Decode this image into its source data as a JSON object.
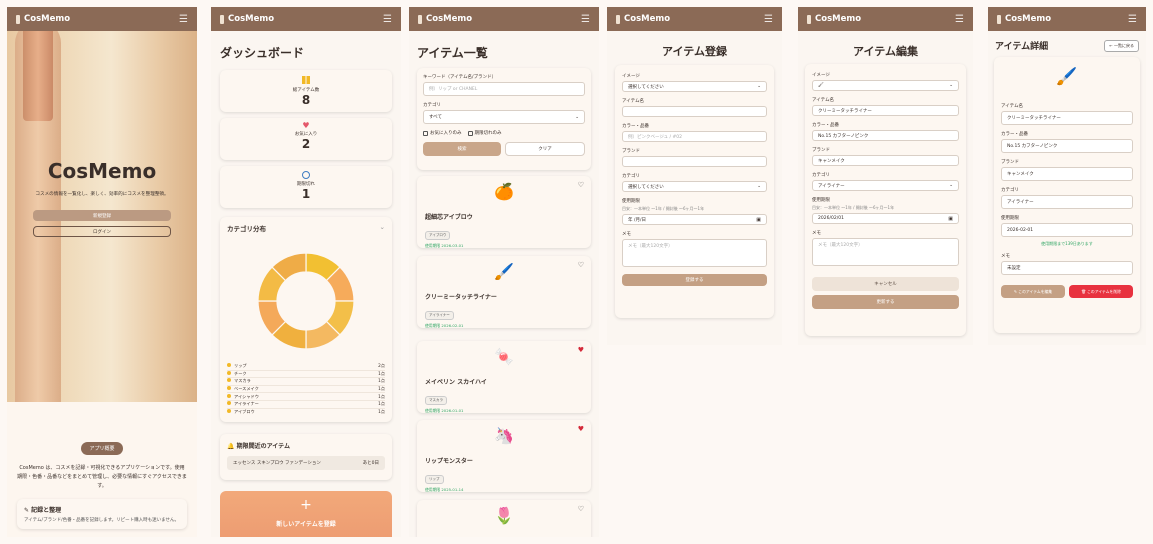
{
  "app": {
    "name": "CosMemo"
  },
  "landing": {
    "hero_title": "CosMemo",
    "hero_text": "コスメの情報を一覧化し、楽しく、効率的にコスメを整理整頓。",
    "register_btn": "新規登録",
    "login_btn": "ログイン",
    "about_badge": "アプリ概要",
    "about_text": "CosMemo は、コスメを記録・可視化できるアプリケーションです。使用期限・色番・品番などをまとめて管理し、必要な情報にすぐアクセスできます。",
    "feature_title": "記録と整理",
    "feature_text": "アイテム/ブランド/色番・品番を記録します。リピート購入時も迷いません。"
  },
  "dashboard": {
    "title": "ダッシュボード",
    "stats": [
      {
        "label": "総アイテム数",
        "value": "8"
      },
      {
        "label": "お気に入り",
        "value": "2"
      },
      {
        "label": "期限切れ",
        "value": "1"
      }
    ],
    "category_title": "カテゴリ分布",
    "legend": [
      {
        "name": "リップ",
        "count": "2点"
      },
      {
        "name": "チーク",
        "count": "1点"
      },
      {
        "name": "マスカラ",
        "count": "1点"
      },
      {
        "name": "ベースメイク",
        "count": "1点"
      },
      {
        "name": "アイシャドウ",
        "count": "1点"
      },
      {
        "name": "アイライナー",
        "count": "1点"
      },
      {
        "name": "アイブロウ",
        "count": "1点"
      }
    ],
    "expiry_title": "期限間近のアイテム",
    "expiry_item": "エッセンス スキンプロウ ファンデーション",
    "expiry_days": "あと0日",
    "add_label": "新しいアイテムを登録",
    "chart_colors": [
      "#f2c032",
      "#f6ab5b",
      "#f3bf49",
      "#f4b961",
      "#f0b03e",
      "#f4a95a",
      "#f3bb45",
      "#efac47"
    ]
  },
  "list": {
    "title": "アイテム一覧",
    "keyword_label": "キーワード（アイテム名/ブランド）",
    "keyword_ph": "例）リップ or CHANEL",
    "category_label": "カテゴリ",
    "category_val": "すべて",
    "fav_only": "お気に入りのみ",
    "expired_only": "期限切れのみ",
    "search_btn": "検索",
    "clear_btn": "クリア",
    "items": [
      {
        "emoji": "🍊",
        "name": "超細芯アイブロウ",
        "tag": "アイブロウ",
        "exp": "使用期限 2026-03-01",
        "fav": false
      },
      {
        "emoji": "🖌️",
        "name": "クリーミータッチライナー",
        "tag": "アイライナー",
        "exp": "使用期限 2026-02-01",
        "fav": false
      },
      {
        "emoji": "🍬",
        "name": "メイベリン スカイハイ",
        "tag": "マスカラ",
        "exp": "使用期限 2026-01-01",
        "fav": true
      },
      {
        "emoji": "🦄",
        "name": "リップモンスター",
        "tag": "リップ",
        "exp": "使用期限 2025-01-14",
        "fav": true
      },
      {
        "emoji": "🌷",
        "name": "",
        "tag": "",
        "exp": "",
        "fav": false
      }
    ]
  },
  "register": {
    "title": "アイテム登録",
    "image_label": "イメージ",
    "image_ph": "選択してください",
    "name_label": "アイテム名",
    "color_label": "カラー・品番",
    "color_ph": "例）ピンクベージュ / #02",
    "brand_label": "ブランド",
    "category_label": "カテゴリ",
    "category_ph": "選択してください",
    "expiry_label": "使用期限",
    "expiry_hint": "目安：一本単位 ～1年 / 開封後 ～6ヶ月～1年",
    "date_ph": "年 /月/日",
    "memo_label": "メモ",
    "memo_ph": "メモ（最大120文字）",
    "submit_btn": "登録する"
  },
  "edit": {
    "title": "アイテム編集",
    "image_label": "イメージ",
    "image_val": "🖌",
    "name_label": "アイテム名",
    "name_val": "クリーミータッチライナー",
    "color_label": "カラー・品番",
    "color_val": "No.15 カフターノピンク",
    "brand_label": "ブランド",
    "brand_val": "キャンメイク",
    "category_label": "カテゴリ",
    "category_val": "アイライナー",
    "expiry_label": "使用期限",
    "expiry_hint": "目安：一本単位 ～1年 / 開封後 ～6ヶ月～1年",
    "date_val": "2026/02/01",
    "memo_label": "メモ",
    "memo_ph": "メモ（最大120文字）",
    "cancel_btn": "キャンセル",
    "update_btn": "更新する"
  },
  "detail": {
    "title": "アイテム詳細",
    "back_btn": "← 一覧に戻る",
    "name_label": "アイテム名",
    "name_val": "クリーミータッチライナー",
    "color_label": "カラー・品番",
    "color_val": "No.15 カフターノピンク",
    "brand_label": "ブランド",
    "brand_val": "キャンメイク",
    "category_label": "カテゴリ",
    "category_val": "アイライナー",
    "expiry_label": "使用期限",
    "expiry_val": "2026-02-01",
    "expiry_note": "使用期限まで139日あります",
    "memo_label": "メモ",
    "memo_val": "未設定",
    "edit_btn": "このアイテムを編集",
    "delete_btn": "このアイテムを削除"
  }
}
